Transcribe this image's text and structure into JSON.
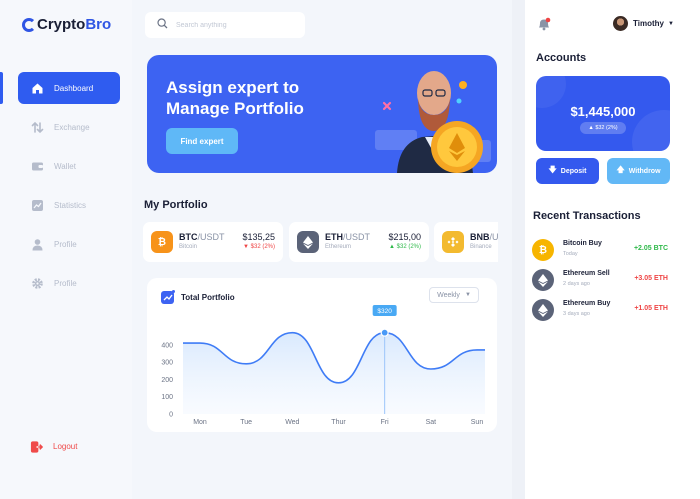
{
  "brand": {
    "name_part1": "Crypto",
    "name_part2": "Bro"
  },
  "sidebar": {
    "items": [
      {
        "label": "Dashboard",
        "icon": "home-icon",
        "active": true
      },
      {
        "label": "Exchange",
        "icon": "exchange-icon",
        "active": false
      },
      {
        "label": "Wallet",
        "icon": "wallet-icon",
        "active": false
      },
      {
        "label": "Statistics",
        "icon": "statistics-icon",
        "active": false
      },
      {
        "label": "Profile",
        "icon": "user-icon",
        "active": false
      },
      {
        "label": "Profile",
        "icon": "gear-icon",
        "active": false
      }
    ],
    "logout_label": "Logout"
  },
  "search": {
    "placeholder": "Search anything"
  },
  "hero": {
    "title": "Assign expert to Manage Portfolio",
    "button_label": "Find expert"
  },
  "portfolio": {
    "title": "My Portfolio",
    "coins": [
      {
        "symbol": "BTC",
        "quote": "/USDT",
        "name": "Bitcoin",
        "price": "$135,25",
        "change": "▼ $32 (2%)",
        "direction": "down",
        "color": "#f7931a",
        "icon": "bitcoin-icon"
      },
      {
        "symbol": "ETH",
        "quote": "/USDT",
        "name": "Ethereum",
        "price": "$215,00",
        "change": "▲ $32 (2%)",
        "direction": "up",
        "color": "#5b6378",
        "icon": "ethereum-icon"
      },
      {
        "symbol": "BNB",
        "quote": "/USDT",
        "name": "Binance",
        "price": "",
        "change": "",
        "direction": "up",
        "color": "#f3ba2f",
        "icon": "binance-icon"
      }
    ]
  },
  "total_portfolio": {
    "title": "Total Portfolio",
    "period": "Weekly",
    "tooltip": "$320"
  },
  "chart_data": {
    "type": "line",
    "categories": [
      "Mon",
      "Tue",
      "Wed",
      "Thur",
      "Fri",
      "Sat",
      "Sun"
    ],
    "y_ticks": [
      0,
      100,
      200,
      300,
      400
    ],
    "ylim": [
      0,
      520
    ],
    "series": [
      {
        "values": [
          410,
          290,
          470,
          180,
          470,
          260,
          370
        ],
        "color": "#3f7cf6"
      }
    ],
    "highlight": {
      "category": "Fri",
      "value": 320,
      "label": "$320"
    },
    "title": "Total Portfolio"
  },
  "header": {
    "user_name": "Timothy"
  },
  "accounts": {
    "title": "Accounts",
    "balance": "$1,445,000",
    "change": "▲ $32 (2%)",
    "deposit_label": "Deposit",
    "withdraw_label": "Withdrow"
  },
  "transactions": {
    "title": "Recent Transactions",
    "items": [
      {
        "title": "Bitcoin Buy",
        "date": "Today",
        "amount": "+2.05 BTC",
        "color": "#f7b500",
        "amount_color": "#2fb94a",
        "icon": "bitcoin-icon"
      },
      {
        "title": "Ethereum Sell",
        "date": "2 days ago",
        "amount": "+3.05 ETH",
        "color": "#5b6378",
        "amount_color": "#ef4444",
        "icon": "ethereum-icon"
      },
      {
        "title": "Ethereum Buy",
        "date": "3 days ago",
        "amount": "+1.05 ETH",
        "color": "#5b6378",
        "amount_color": "#ef4444",
        "icon": "ethereum-icon"
      }
    ]
  },
  "colors": {
    "accent": "#2f5cf0",
    "up": "#2fb94a",
    "down": "#ef4444"
  }
}
